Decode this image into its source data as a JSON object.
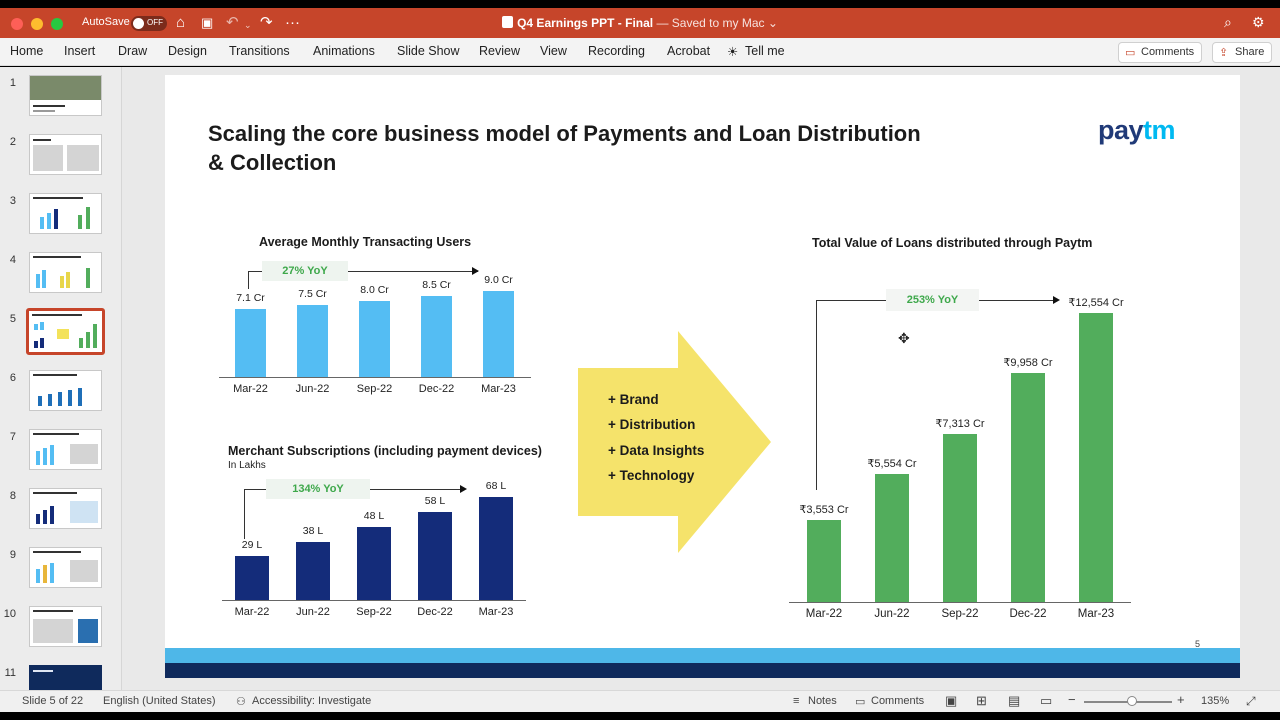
{
  "titlebar": {
    "autosave_label": "AutoSave",
    "autosave_state": "OFF",
    "doc_title": "Q4 Earnings PPT - Final",
    "saved_status": " — Saved to my Mac ⌄",
    "icons": [
      "home-icon",
      "save-icon",
      "undo-icon",
      "redo-icon",
      "more-icon",
      "search-icon",
      "settings-icon"
    ]
  },
  "ribbon": {
    "tabs": [
      "Home",
      "Insert",
      "Draw",
      "Design",
      "Transitions",
      "Animations",
      "Slide Show",
      "Review",
      "View",
      "Recording",
      "Acrobat",
      "Tell me"
    ],
    "comments_label": "Comments",
    "share_label": "Share"
  },
  "thumbnails": {
    "numbers": [
      "1",
      "2",
      "3",
      "4",
      "5",
      "6",
      "7",
      "8",
      "9",
      "10",
      "11"
    ],
    "selected": 5
  },
  "slide": {
    "title_line1": "Scaling the core business model of Payments and Loan Distribution",
    "title_line2": "& Collection",
    "logo_pay": "pay",
    "logo_tm": "tm",
    "arrow_items": [
      "+ Brand",
      "+ Distribution",
      "+ Data Insights",
      "+ Technology"
    ],
    "page_number": "5"
  },
  "chart_data": [
    {
      "type": "bar",
      "title": "Average Monthly Transacting Users",
      "yoy": "27% YoY",
      "categories": [
        "Mar-22",
        "Jun-22",
        "Sep-22",
        "Dec-22",
        "Mar-23"
      ],
      "values": [
        7.1,
        7.5,
        8.0,
        8.5,
        9.0
      ],
      "labels": [
        "7.1 Cr",
        "7.5 Cr",
        "8.0 Cr",
        "8.5 Cr",
        "9.0 Cr"
      ],
      "color": "#54bdf3"
    },
    {
      "type": "bar",
      "title": "Merchant Subscriptions (including payment devices)",
      "subtitle": "In Lakhs",
      "yoy": "134% YoY",
      "categories": [
        "Mar-22",
        "Jun-22",
        "Sep-22",
        "Dec-22",
        "Mar-23"
      ],
      "values": [
        29,
        38,
        48,
        58,
        68
      ],
      "labels": [
        "29 L",
        "38 L",
        "48 L",
        "58 L",
        "68 L"
      ],
      "color": "#142c7a"
    },
    {
      "type": "bar",
      "title": "Total Value of Loans distributed through Paytm",
      "yoy": "253% YoY",
      "categories": [
        "Mar-22",
        "Jun-22",
        "Sep-22",
        "Dec-22",
        "Mar-23"
      ],
      "values": [
        3553,
        5554,
        7313,
        9958,
        12554
      ],
      "labels": [
        "₹3,553 Cr",
        "₹5,554 Cr",
        "₹7,313 Cr",
        "₹9,958 Cr",
        "₹12,554 Cr"
      ],
      "color": "#52ad5c"
    }
  ],
  "statusbar": {
    "slide_info": "Slide 5 of 22",
    "language": "English (United States)",
    "accessibility": "Accessibility: Investigate",
    "notes": "Notes",
    "comments": "Comments",
    "zoom": "135%"
  }
}
